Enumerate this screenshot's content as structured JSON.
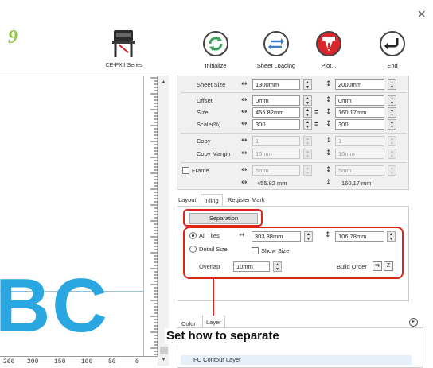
{
  "window": {
    "close_glyph": "×"
  },
  "brand_fragment": "9",
  "plotter": {
    "label": "CE-PXII Series",
    "icon": "plotter-icon"
  },
  "toolbar": {
    "initialize": "Initialize",
    "sheet_loading": "Sheet Loading",
    "plot": "Plot...",
    "end": "End"
  },
  "canvas": {
    "letters": "BC",
    "ruler_labels": [
      "260",
      "200",
      "150",
      "100",
      "50",
      "0"
    ]
  },
  "settings": {
    "sheet_size": {
      "label": "Sheet Size",
      "width": "1300mm",
      "height": "2000mm"
    },
    "offset": {
      "label": "Offset",
      "x": "0mm",
      "y": "0mm"
    },
    "size": {
      "label": "Size",
      "width": "455.82mm",
      "height": "160.17mm"
    },
    "scale": {
      "label": "Scale(%)",
      "x": "300",
      "y": "300"
    },
    "copy": {
      "label": "Copy",
      "x": "1",
      "y": "1"
    },
    "copy_margin": {
      "label": "Copy Margin",
      "x": "10mm",
      "y": "10mm"
    },
    "frame": {
      "label": "Frame",
      "x": "5mm",
      "y": "5mm",
      "checked": false
    },
    "total_width": "455.82 mm",
    "total_height": "160.17 mm"
  },
  "tabs": {
    "layout": "Layout",
    "tiling": "Tiling",
    "register_mark": "Register Mark"
  },
  "tiling": {
    "separation_label": "Separation",
    "all_tiles_label": "All Tiles",
    "all_tiles_checked": true,
    "tile_width": "303.88mm",
    "tile_height": "106.78mm",
    "detail_size_label": "Detail Size",
    "show_size_label": "Show Size",
    "overlap_label": "Overlap",
    "overlap_value": "10mm",
    "build_order_label": "Build Order"
  },
  "layer_tabs": {
    "color": "Color",
    "layer": "Layer"
  },
  "layer_row_label": "FC Contour Layer",
  "callout": "Set how to separate",
  "accent_color": "#e2231a",
  "highlight_color": "#2aa7e1"
}
